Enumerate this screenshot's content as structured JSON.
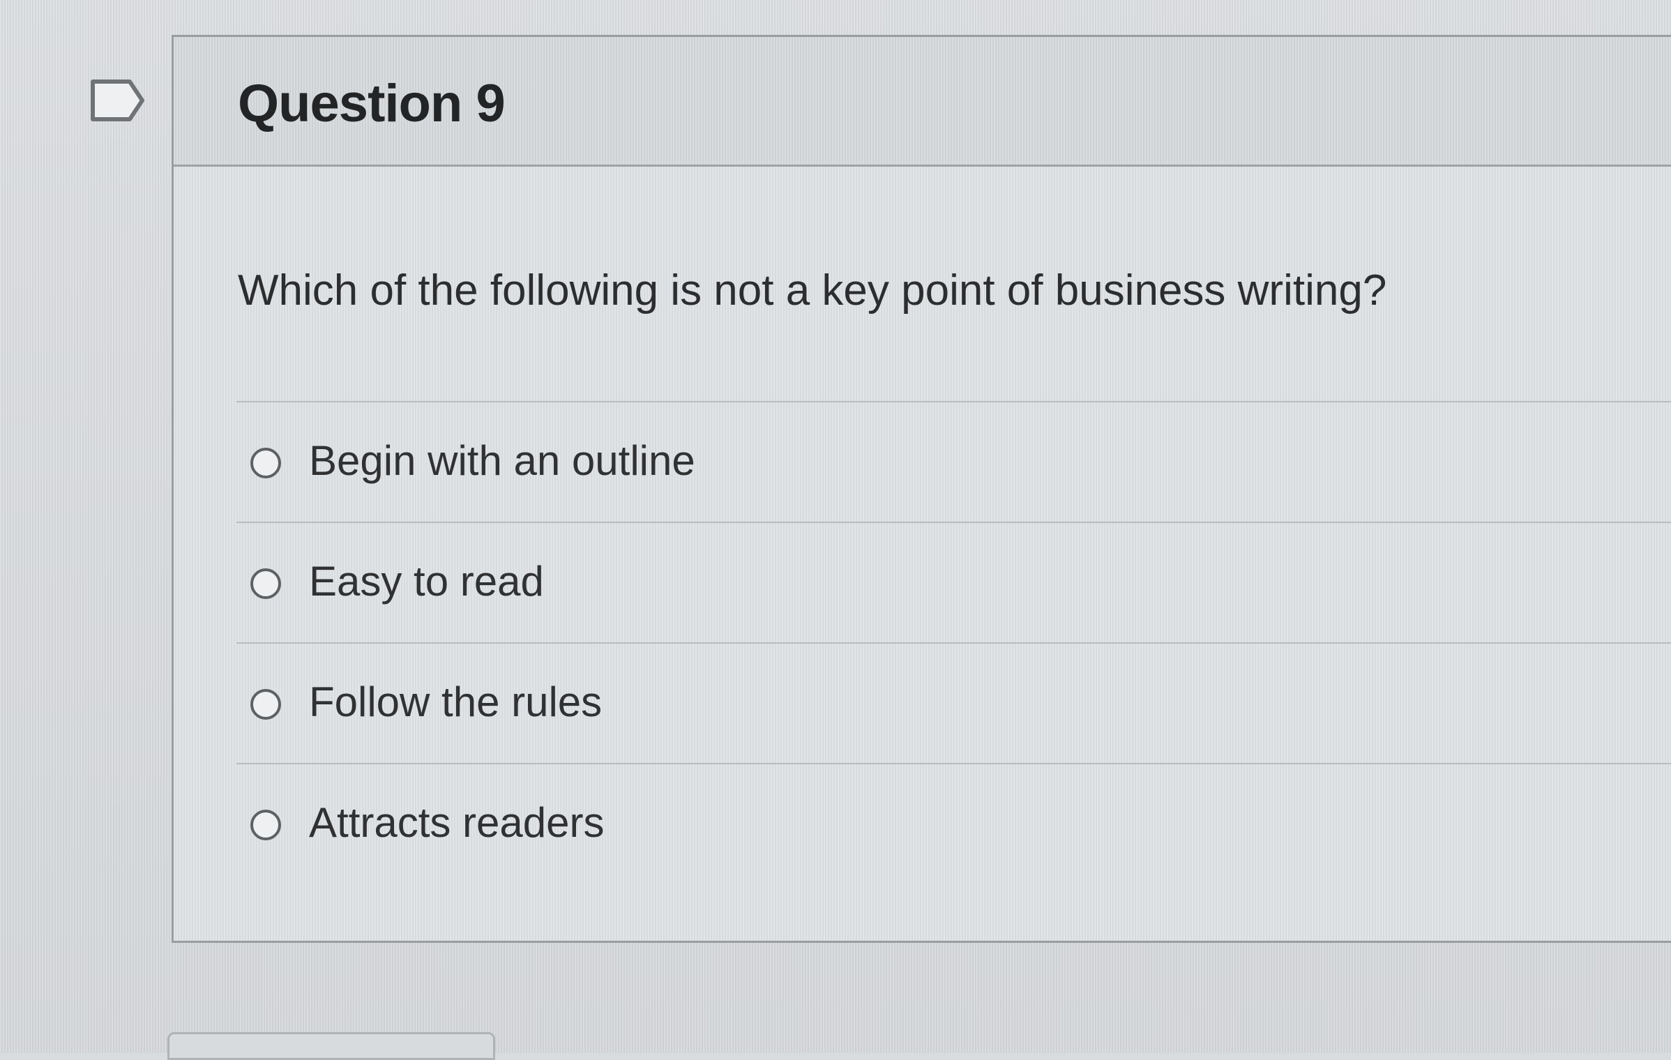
{
  "question": {
    "flag_icon": "flag-outline-icon",
    "title": "Question 9",
    "prompt": "Which of the following is not a key point of business writing?",
    "answers": [
      {
        "label": "Begin with an outline",
        "selected": false
      },
      {
        "label": "Easy to read",
        "selected": false
      },
      {
        "label": "Follow the rules",
        "selected": false
      },
      {
        "label": "Attracts readers",
        "selected": false
      }
    ]
  },
  "colors": {
    "background": "#d9dcdf",
    "card": "#dfe2e4",
    "header": "#d6d9dc",
    "text": "#2d2f31",
    "border": "#9a9d9f"
  }
}
